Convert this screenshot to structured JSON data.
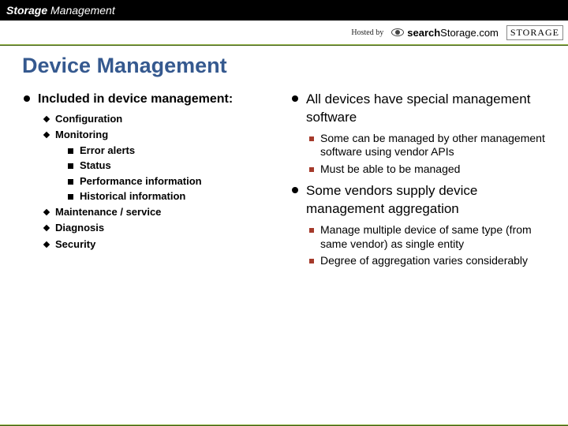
{
  "header": {
    "brand1": "Storage",
    "brand2": " Management",
    "hosted_by": "Hosted by",
    "ss_bold": "search",
    "ss_rest": "Storage.com",
    "storage_box": "STORAGE"
  },
  "title": "Device Management",
  "left": {
    "h": "Included in device management:",
    "items": [
      {
        "label": "Configuration"
      },
      {
        "label": "Monitoring",
        "sub": [
          "Error alerts",
          "Status",
          "Performance information",
          "Historical information"
        ]
      },
      {
        "label": "Maintenance / service"
      },
      {
        "label": "Diagnosis"
      },
      {
        "label": "Security"
      }
    ]
  },
  "right": {
    "blocks": [
      {
        "h": "All devices have special management software",
        "sub": [
          "Some can be managed by other management software using vendor APIs",
          "Must be able to be managed"
        ]
      },
      {
        "h": "Some vendors supply device management aggregation",
        "sub": [
          "Manage multiple device of same type (from same vendor) as single entity",
          "Degree of aggregation varies considerably"
        ]
      }
    ]
  }
}
